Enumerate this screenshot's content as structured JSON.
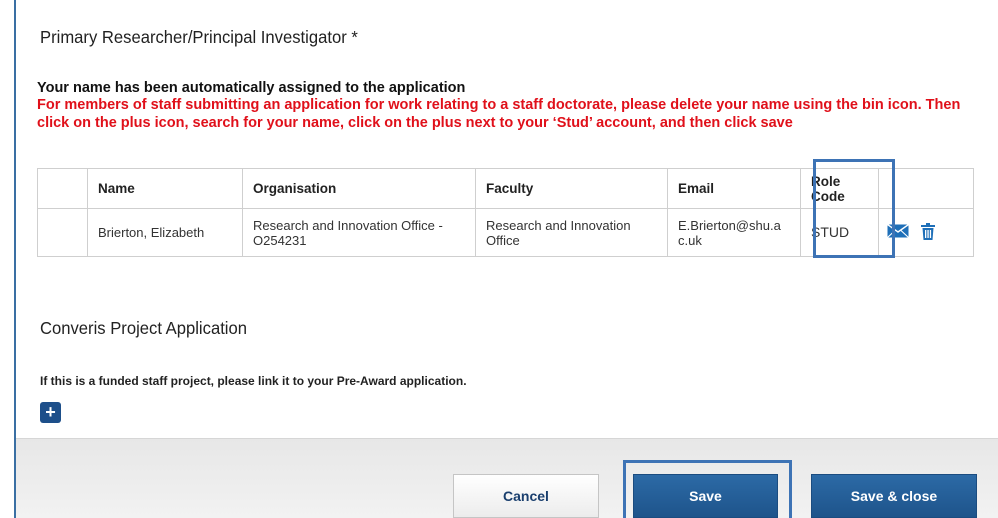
{
  "researcher_section": {
    "title": "Primary Researcher/Principal Investigator *",
    "auto_assigned_msg": "Your name has been automatically assigned to the application",
    "staff_instruction": "For members of staff submitting an application for work relating to a staff doctorate, please delete your name using the bin icon. Then click on the plus icon, search for your name, click on the plus next to your ‘Stud’ account, and then click save"
  },
  "table": {
    "headers": [
      "",
      "Name",
      "Organisation",
      "Faculty",
      "Email",
      "Role Code",
      ""
    ],
    "rows": [
      {
        "name": "Brierton, Elizabeth",
        "organisation": "Research and Innovation Office - O254231",
        "faculty": "Research and Innovation Office",
        "email": "E.Brierton@shu.ac.uk",
        "role_code": "STUD",
        "actions": [
          "mail-icon",
          "trash-icon"
        ]
      }
    ]
  },
  "converis_section": {
    "title": "Converis Project Application",
    "note": "If this is a funded staff project, please link it to your Pre-Award application.",
    "add_icon": "plus-icon"
  },
  "footer": {
    "cancel_label": "Cancel",
    "save_label": "Save",
    "save_close_label": "Save & close"
  },
  "colors": {
    "accent": "#1e548b",
    "warning_text": "#e0101a",
    "highlight_box": "#3d73b5"
  }
}
